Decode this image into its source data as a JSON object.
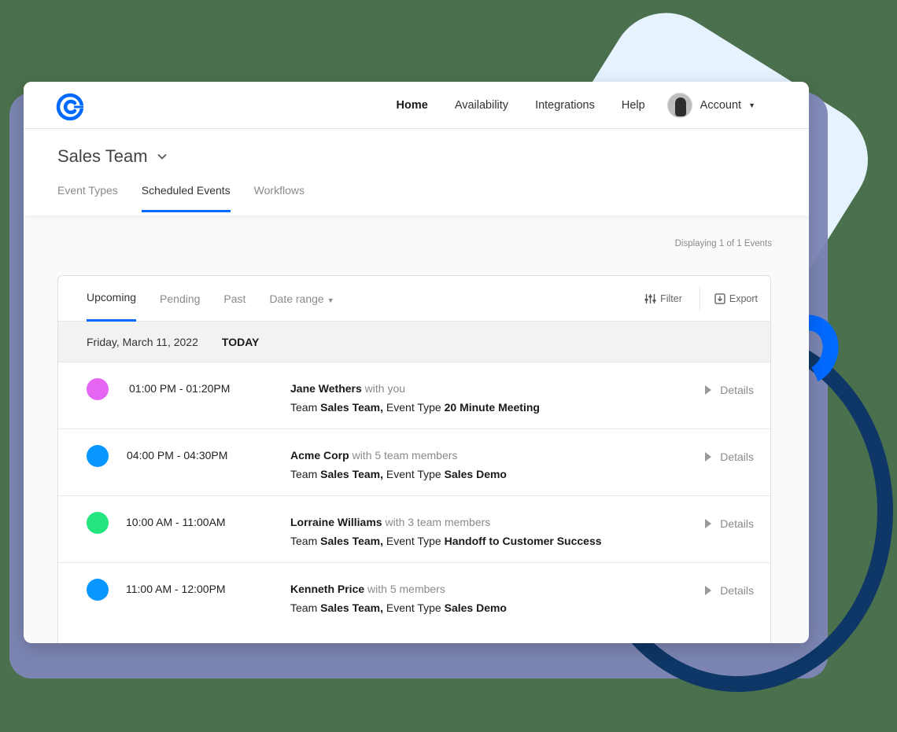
{
  "colors": {
    "accent": "#0069ff",
    "dot_pink": "#e466f2",
    "dot_blue": "#0a96ff",
    "dot_green": "#25e57e"
  },
  "nav": {
    "logo": "calendly-logo-icon",
    "items": [
      {
        "label": "Home",
        "active": true
      },
      {
        "label": "Availability"
      },
      {
        "label": "Integrations"
      },
      {
        "label": "Help"
      }
    ],
    "account_label": "Account"
  },
  "header": {
    "team_title": "Sales Team",
    "tabs": [
      {
        "label": "Event Types"
      },
      {
        "label": "Scheduled Events",
        "active": true
      },
      {
        "label": "Workflows"
      }
    ]
  },
  "displaying_text": "Displaying 1 of 1 Events",
  "card": {
    "tabs": [
      {
        "label": "Upcoming",
        "active": true
      },
      {
        "label": "Pending"
      },
      {
        "label": "Past"
      },
      {
        "label": "Date range"
      }
    ],
    "filter_label": "Filter",
    "export_label": "Export",
    "date_label": "Friday, March 11, 2022",
    "today_label": "TODAY",
    "events": [
      {
        "color": "#e466f2",
        "time": "01:00 PM - 01:20PM",
        "name": "Jane Wethers",
        "with_text": "with you",
        "team_prefix": "Team",
        "team": "Sales Team,",
        "type_prefix": "Event Type",
        "event_type": "20 Minute Meeting",
        "details_label": "Details"
      },
      {
        "color": "#0a96ff",
        "time": "04:00 PM - 04:30PM",
        "name": "Acme Corp",
        "with_text": "with 5 team members",
        "team_prefix": "Team",
        "team": "Sales Team,",
        "type_prefix": "Event Type",
        "event_type": "Sales Demo",
        "details_label": "Details"
      },
      {
        "color": "#25e57e",
        "time": "10:00 AM - 11:00AM",
        "name": "Lorraine Williams",
        "with_text": "with 3 team members",
        "team_prefix": "Team",
        "team": "Sales Team,",
        "type_prefix": "Event Type",
        "event_type": "Handoff to Customer Success",
        "details_label": "Details"
      },
      {
        "color": "#0a96ff",
        "time": "11:00 AM - 12:00PM",
        "name": "Kenneth Price",
        "with_text": "with 5 members",
        "team_prefix": "Team",
        "team": "Sales Team,",
        "type_prefix": "Event Type",
        "event_type": "Sales Demo",
        "details_label": "Details"
      }
    ]
  }
}
